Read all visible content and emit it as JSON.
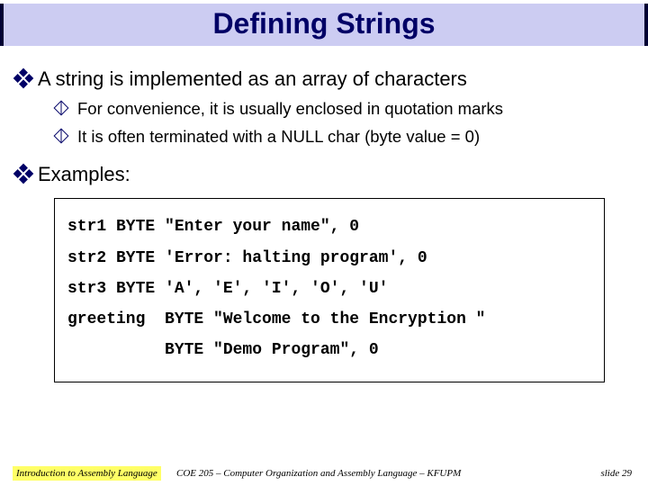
{
  "title": "Defining Strings",
  "bullets": [
    {
      "text": "A string is implemented as an array of characters",
      "sub": [
        "For convenience, it is usually enclosed in quotation marks",
        "It is often terminated with a NULL char (byte value = 0)"
      ]
    },
    {
      "text": "Examples:",
      "sub": []
    }
  ],
  "code": {
    "lines": [
      "str1 BYTE \"Enter your name\", 0",
      "str2 BYTE 'Error: halting program', 0",
      "str3 BYTE 'A', 'E', 'I', 'O', 'U'",
      "greeting  BYTE \"Welcome to the Encryption \"",
      "          BYTE \"Demo Program\", 0"
    ]
  },
  "footer": {
    "left": "Introduction to Assembly Language",
    "mid": "COE 205 – Computer Organization and Assembly Language – KFUPM",
    "right": "slide 29"
  }
}
